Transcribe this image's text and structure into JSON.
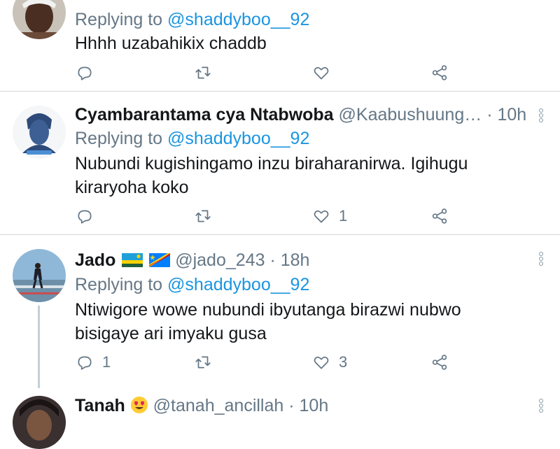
{
  "tweets": [
    {
      "reply_prefix": "Replying to",
      "reply_user": "@shaddyboo__92",
      "text": "Hhhh uzabahikix chaddb",
      "reply_count": "",
      "retweet_count": "",
      "like_count": ""
    },
    {
      "name": "Cyambarantama cya Ntabwoba",
      "handle": "@Kaabushuung…",
      "dot": "·",
      "time": "10h",
      "reply_prefix": "Replying to",
      "reply_user": "@shaddyboo__92",
      "text": "Nubundi kugishingamo inzu biraharanirwa.  Igihugu kiraryoha koko",
      "reply_count": "",
      "retweet_count": "",
      "like_count": "1"
    },
    {
      "name": "Jado",
      "handle": "@jado_243",
      "dot": "·",
      "time": "18h",
      "reply_prefix": "Replying to",
      "reply_user": "@shaddyboo__92",
      "text": "Ntiwigore wowe nubundi ibyutanga birazwi nubwo bisigaye ari imyaku gusa",
      "reply_count": "1",
      "retweet_count": "",
      "like_count": "3"
    },
    {
      "name": "Tanah",
      "handle": "@tanah_ancillah",
      "dot": "·",
      "time": "10h"
    }
  ],
  "icons": [
    "reply-icon",
    "retweet-icon",
    "like-icon",
    "share-icon",
    "more-icon"
  ],
  "colors": {
    "link": "#1b95e0",
    "secondary": "#657786",
    "divider": "#d3d8dc"
  }
}
